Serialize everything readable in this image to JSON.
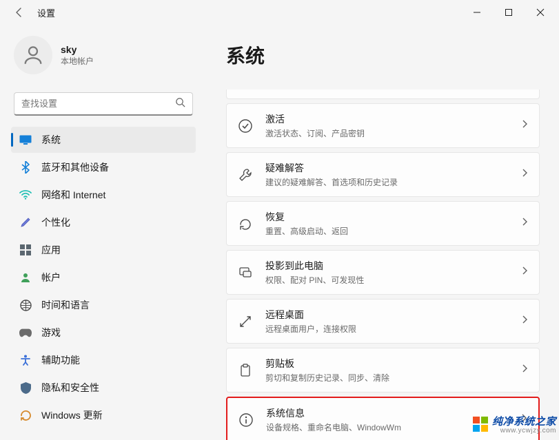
{
  "window": {
    "title": "设置"
  },
  "user": {
    "name": "sky",
    "subtitle": "本地帐户"
  },
  "search": {
    "placeholder": "查找设置"
  },
  "sidebar": [
    {
      "key": "system",
      "label": "系统",
      "icon": "display-icon",
      "selected": true
    },
    {
      "key": "bluetooth",
      "label": "蓝牙和其他设备",
      "icon": "bluetooth-icon",
      "selected": false
    },
    {
      "key": "network",
      "label": "网络和 Internet",
      "icon": "wifi-icon",
      "selected": false
    },
    {
      "key": "personalization",
      "label": "个性化",
      "icon": "brush-icon",
      "selected": false
    },
    {
      "key": "apps",
      "label": "应用",
      "icon": "apps-icon",
      "selected": false
    },
    {
      "key": "accounts",
      "label": "帐户",
      "icon": "person-icon",
      "selected": false
    },
    {
      "key": "time",
      "label": "时间和语言",
      "icon": "clock-globe-icon",
      "selected": false
    },
    {
      "key": "gaming",
      "label": "游戏",
      "icon": "gamepad-icon",
      "selected": false
    },
    {
      "key": "accessibility",
      "label": "辅助功能",
      "icon": "accessibility-icon",
      "selected": false
    },
    {
      "key": "privacy",
      "label": "隐私和安全性",
      "icon": "shield-icon",
      "selected": false
    },
    {
      "key": "update",
      "label": "Windows 更新",
      "icon": "update-icon",
      "selected": false
    }
  ],
  "main": {
    "heading": "系统",
    "cards": [
      {
        "key": "activation",
        "title": "激活",
        "subtitle": "激活状态、订阅、产品密钥",
        "icon": "check-circle-icon"
      },
      {
        "key": "troubleshoot",
        "title": "疑难解答",
        "subtitle": "建议的疑难解答、首选项和历史记录",
        "icon": "wrench-icon"
      },
      {
        "key": "recovery",
        "title": "恢复",
        "subtitle": "重置、高级启动、返回",
        "icon": "recovery-icon"
      },
      {
        "key": "project",
        "title": "投影到此电脑",
        "subtitle": "权限、配对 PIN、可发现性",
        "icon": "project-icon"
      },
      {
        "key": "remote",
        "title": "远程桌面",
        "subtitle": "远程桌面用户，连接权限",
        "icon": "remote-icon"
      },
      {
        "key": "clipboard",
        "title": "剪贴板",
        "subtitle": "剪切和复制历史记录、同步、清除",
        "icon": "clipboard-icon"
      },
      {
        "key": "about",
        "title": "系统信息",
        "subtitle": "设备规格、重命名电脑、Windo‍wWm",
        "icon": "info-icon",
        "highlight": true
      }
    ]
  },
  "watermark": {
    "text": "纯净系统之家",
    "url": "www.ycwjzy.com"
  }
}
